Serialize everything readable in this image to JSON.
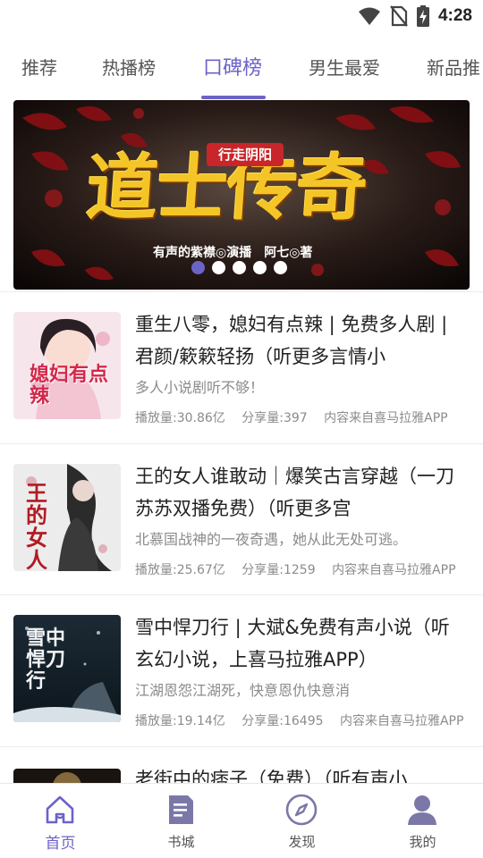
{
  "status_bar": {
    "time": "4:28"
  },
  "tabs": [
    {
      "label": "推荐"
    },
    {
      "label": "热播榜"
    },
    {
      "label": "口碑榜",
      "active": true
    },
    {
      "label": "男生最爱"
    },
    {
      "label": "新品推"
    }
  ],
  "banner": {
    "tag": "行走阴阳",
    "title": "道士传奇",
    "subtitle": "有声的紫襟◎演播　阿七◎著",
    "slide_count": 5,
    "active_slide": 1
  },
  "items": [
    {
      "title": "重生八零，媳妇有点辣 | 免费多人剧 | 君颜/簌簌轻扬（听更多言情小",
      "desc": "多人小说剧听不够！",
      "plays": "播放量:30.86亿",
      "shares": "分享量:397",
      "source": "内容来自喜马拉雅APP",
      "cover_text": "媳妇有点辣"
    },
    {
      "title": "王的女人谁敢动｜爆笑古言穿越（一刀苏苏双播免费）（听更多宫",
      "desc": "北慕国战神的一夜奇遇，她从此无处可逃。",
      "plays": "播放量:25.67亿",
      "shares": "分享量:1259",
      "source": "内容来自喜马拉雅APP",
      "cover_text": "王的女人"
    },
    {
      "title": "雪中悍刀行 | 大斌&免费有声小说（听玄幻小说，上喜马拉雅APP）",
      "desc": "江湖恩怨江湖死，快意恩仇快意消",
      "plays": "播放量:19.14亿",
      "shares": "分享量:16495",
      "source": "内容来自喜马拉雅APP",
      "cover_text": "雪中悍刀行"
    },
    {
      "title": "老街中的痞子（免费）（听有声小",
      "desc": "",
      "plays": "",
      "shares": "",
      "source": "",
      "cover_text": ""
    }
  ],
  "bottom_nav": [
    {
      "label": "首页",
      "icon": "home-icon",
      "active": true
    },
    {
      "label": "书城",
      "icon": "book-icon"
    },
    {
      "label": "发现",
      "icon": "compass-icon"
    },
    {
      "label": "我的",
      "icon": "user-icon"
    }
  ],
  "colors": {
    "accent": "#6c63c7",
    "text": "#222222",
    "muted": "#8b8b8b"
  }
}
